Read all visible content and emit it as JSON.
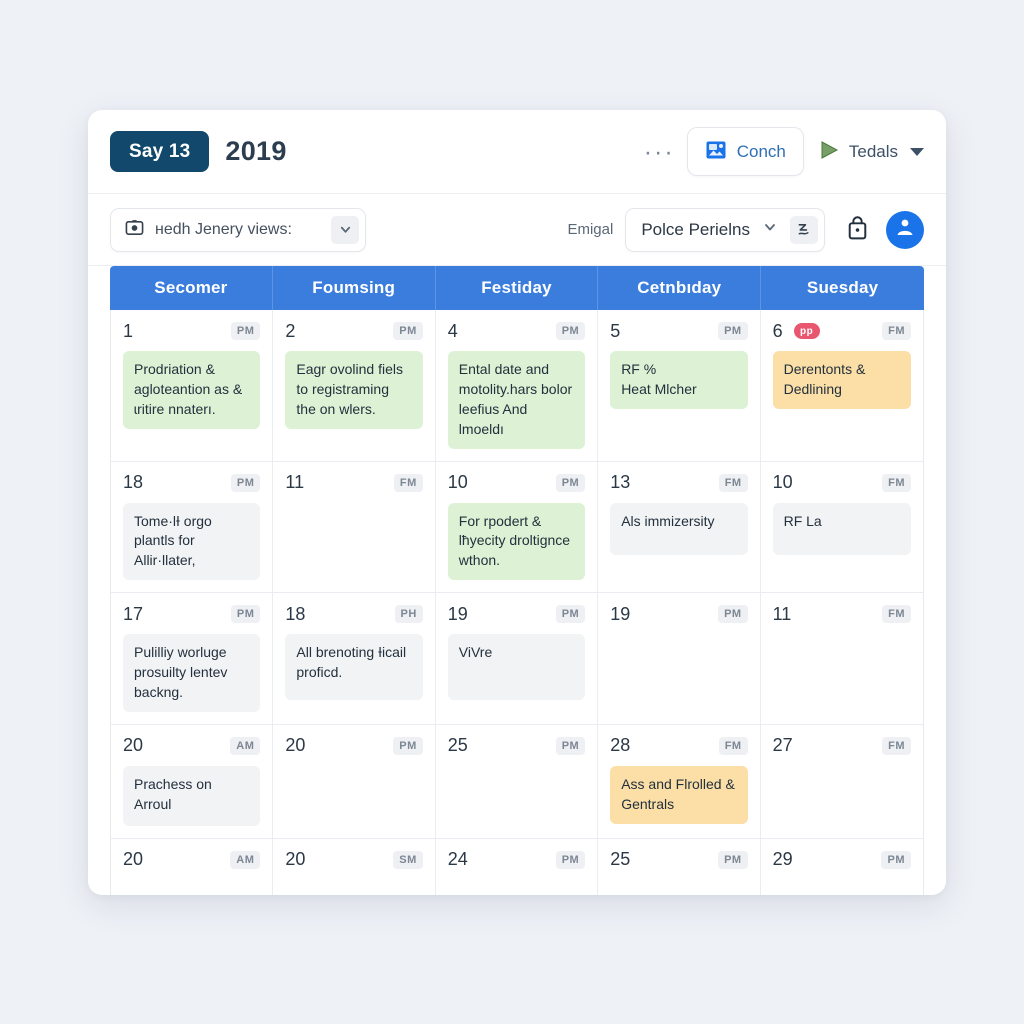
{
  "toolbar": {
    "date_pill": "Say 13",
    "year": "2019",
    "kebab": "···",
    "conch_label": "Conch",
    "conch_icon": "image-card-icon",
    "tedals_label": "Tedals",
    "tedals_icon": "play-triangle-icon",
    "tedals_caret": "chevron-down-icon"
  },
  "subbar": {
    "views_icon": "camera-icon",
    "views_label": "нedh Jenery views:",
    "views_caret": "chevron-down-icon",
    "emigal_label": "Emigal",
    "police_label": "Polce Perielns",
    "police_caret": "chevron-down-icon",
    "police_action_icon": "signature-icon",
    "bag_icon": "lock-bag-icon",
    "avatar_icon": "user-avatar-icon"
  },
  "calendar": {
    "columns": [
      "Secomer",
      "Foumsing",
      "Festiday",
      "Cetnbıday",
      "Suesday"
    ],
    "rows": [
      [
        {
          "day": "1",
          "ampm": "PM",
          "badge": null,
          "event": "Prodriation & agloteantion as & ɩritire nnaterı.",
          "chip": "green"
        },
        {
          "day": "2",
          "ampm": "PM",
          "badge": null,
          "event": "Eagr ovolind fiels to registraming the on wlers.",
          "chip": "green"
        },
        {
          "day": "4",
          "ampm": "PM",
          "badge": null,
          "event": "Ental date and motolity.hars bolor leefius And lmoeldı",
          "chip": "green"
        },
        {
          "day": "5",
          "ampm": "PM",
          "badge": null,
          "event": "RF %\nHeat Mlcher",
          "chip": "green"
        },
        {
          "day": "6",
          "ampm": "FM",
          "badge": "рр",
          "event": "Derentonts & Dedlining",
          "chip": "orange"
        }
      ],
      [
        {
          "day": "18",
          "ampm": "PM",
          "badge": null,
          "event": "Tome·lƗ orgo plantls for Allir·llater,",
          "chip": "grey"
        },
        {
          "day": "11",
          "ampm": "FM",
          "badge": null,
          "event": null,
          "chip": null
        },
        {
          "day": "10",
          "ampm": "PM",
          "badge": null,
          "event": "For rpodert & lħyecity droltignce wthon.",
          "chip": "green"
        },
        {
          "day": "13",
          "ampm": "FM",
          "badge": null,
          "event": "Als immizersity",
          "chip": "grey"
        },
        {
          "day": "10",
          "ampm": "FM",
          "badge": null,
          "event": "RF La",
          "chip": "grey"
        }
      ],
      [
        {
          "day": "17",
          "ampm": "PM",
          "badge": null,
          "event": "Pulilliy worluge prosuilty lentev backng.",
          "chip": "grey"
        },
        {
          "day": "18",
          "ampm": "PH",
          "badge": null,
          "event": "All brenoting Ɨicail proficd.",
          "chip": "grey"
        },
        {
          "day": "19",
          "ampm": "PM",
          "badge": null,
          "event": "ViVre",
          "chip": "grey"
        },
        {
          "day": "19",
          "ampm": "PM",
          "badge": null,
          "event": null,
          "chip": null
        },
        {
          "day": "11",
          "ampm": "FM",
          "badge": null,
          "event": null,
          "chip": null
        }
      ],
      [
        {
          "day": "20",
          "ampm": "AM",
          "badge": null,
          "event": "Prachess on Arroul",
          "chip": "grey"
        },
        {
          "day": "20",
          "ampm": "PM",
          "badge": null,
          "event": null,
          "chip": null
        },
        {
          "day": "25",
          "ampm": "PM",
          "badge": null,
          "event": null,
          "chip": null
        },
        {
          "day": "28",
          "ampm": "FM",
          "badge": null,
          "event": "Ass and Flrolled & Gentrals",
          "chip": "orange"
        },
        {
          "day": "27",
          "ampm": "FM",
          "badge": null,
          "event": null,
          "chip": null
        }
      ],
      [
        {
          "day": "20",
          "ampm": "AM",
          "badge": null,
          "event": null,
          "chip": null
        },
        {
          "day": "20",
          "ampm": "SM",
          "badge": null,
          "event": null,
          "chip": null
        },
        {
          "day": "24",
          "ampm": "PM",
          "badge": null,
          "event": null,
          "chip": null
        },
        {
          "day": "25",
          "ampm": "PM",
          "badge": null,
          "event": null,
          "chip": null
        },
        {
          "day": "29",
          "ampm": "PM",
          "badge": null,
          "event": null,
          "chip": null
        }
      ]
    ]
  },
  "colors": {
    "page_bg": "#eef1f6",
    "card_bg": "#ffffff",
    "date_pill": "#11486b",
    "header_blue": "#3b7ddd",
    "chip_green": "#ddf2d5",
    "chip_orange": "#fbdfa6",
    "chip_grey": "#f1f3f5",
    "badge_red": "#e8566f",
    "accent_blue": "#1a73e8",
    "link_blue": "#2f6fb5"
  }
}
